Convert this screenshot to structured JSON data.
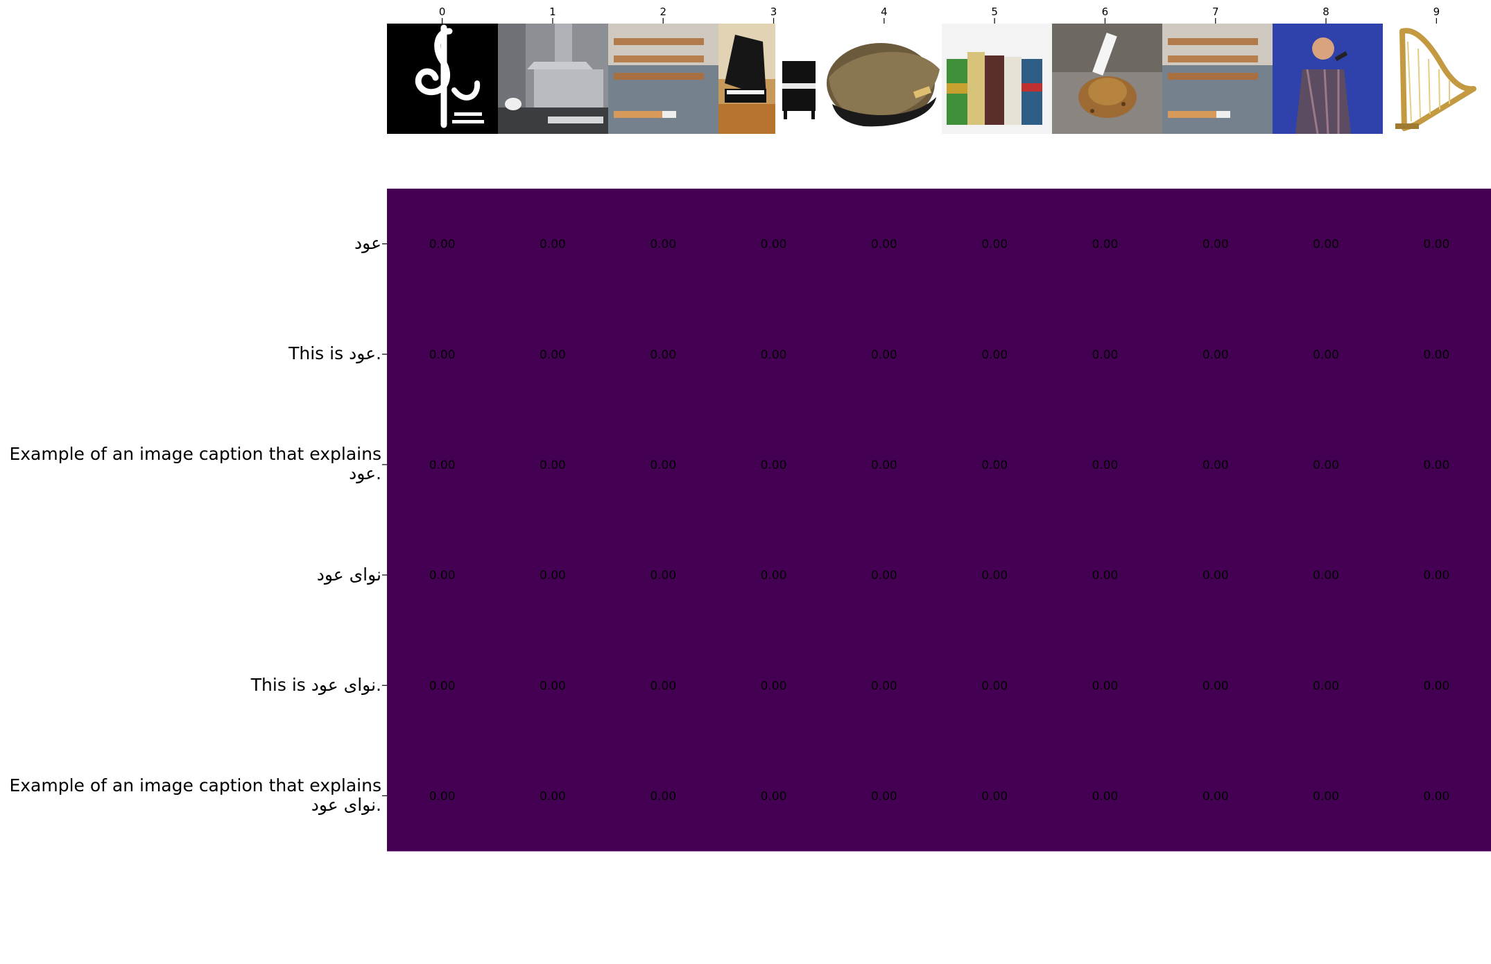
{
  "chart_data": {
    "type": "heatmap",
    "title": "",
    "xlabel": "",
    "ylabel": "",
    "x_tick_labels": [
      "0",
      "1",
      "2",
      "3",
      "4",
      "5",
      "6",
      "7",
      "8",
      "9"
    ],
    "x_tick_images": [
      "navaa-logo-treble-clef",
      "kitchen-range-hood",
      "smoking-cigarettes",
      "grand-piano",
      "upright-piano-and-oud",
      "cigarette-packs",
      "cigarette-and-tobacco",
      "smoking-cigarettes",
      "singer-with-microphone",
      "golden-harp"
    ],
    "y_tick_labels": [
      "عود",
      "This is عود.",
      "Example of an image caption that explains عود.",
      "نوای عود",
      "This is نوای عود.",
      "Example of an image caption that explains نوای عود."
    ],
    "values": [
      [
        0.0,
        0.0,
        0.0,
        0.0,
        0.0,
        0.0,
        0.0,
        0.0,
        0.0,
        0.0
      ],
      [
        0.0,
        0.0,
        0.0,
        0.0,
        0.0,
        0.0,
        0.0,
        0.0,
        0.0,
        0.0
      ],
      [
        0.0,
        0.0,
        0.0,
        0.0,
        0.0,
        0.0,
        0.0,
        0.0,
        0.0,
        0.0
      ],
      [
        0.0,
        0.0,
        0.0,
        0.0,
        0.0,
        0.0,
        0.0,
        0.0,
        0.0,
        0.0
      ],
      [
        0.0,
        0.0,
        0.0,
        0.0,
        0.0,
        0.0,
        0.0,
        0.0,
        0.0,
        0.0
      ],
      [
        0.0,
        0.0,
        0.0,
        0.0,
        0.0,
        0.0,
        0.0,
        0.0,
        0.0,
        0.0
      ]
    ],
    "cell_label_format": "0.00",
    "colormap": "viridis",
    "cell_color": "#440154",
    "text_color": "#000000",
    "grid": false
  }
}
